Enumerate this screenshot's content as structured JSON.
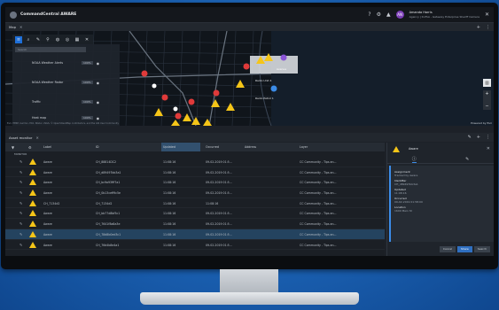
{
  "colors": {
    "background": "#1a5fb0",
    "accent": "#1e6fd9",
    "warning": "#f5c518",
    "selected_row": "#24435f"
  },
  "app": {
    "title": "CommandCentral AWARE",
    "header_icons": [
      "help-icon",
      "gear-icon",
      "bell-icon"
    ],
    "user": {
      "initials": "AN",
      "name": "Amanda Harris",
      "agency": "Agency | D-PSA - Gateway Enterprise Sheriff Camera"
    }
  },
  "map_panel": {
    "tab_label": "Map",
    "tools": [
      "layers-icon",
      "search-icon",
      "draw-icon",
      "pin-icon",
      "bulb-icon",
      "target-icon",
      "calendar-icon",
      "close-icon"
    ],
    "layer_search_placeholder": "Search",
    "layers": [
      {
        "name": "NOAA Weather Alerts",
        "pct": "100%"
      },
      {
        "name": "NOAA Weather Radar",
        "pct": "100%"
      },
      {
        "name": "Traffic",
        "pct": "100%"
      },
      {
        "name": "Heat map",
        "pct": "100%"
      }
    ],
    "labels": [
      {
        "text": "Avenue"
      },
      {
        "text": "Radio Patrol 1"
      },
      {
        "text": "Radio Unit 4"
      }
    ],
    "attribution": "Esri, HERE, Garmin, FAO, NOAA, USGS, © OpenStreetMap contributors, and the GIS User Community",
    "powered_by": "Powered by Esri"
  },
  "asset_monitor": {
    "title": "Asset monitor",
    "columns": [
      "Label",
      "ID",
      "Updated",
      "Occurred",
      "Address",
      "Layer"
    ],
    "group_label": "MONITOR",
    "rows": [
      {
        "label": "Aware",
        "id": "CH_88814DC2",
        "updated": "11:08:16",
        "occurred": "09-02-2019 01:5...",
        "address": "",
        "layer": "CC Community - Tips an..."
      },
      {
        "label": "Aware",
        "id": "CH_d89497bb3a1",
        "updated": "11:08:16",
        "occurred": "09-02-2019 01:5...",
        "address": "",
        "layer": "CC Community - Tips an..."
      },
      {
        "label": "Aware",
        "id": "CH_bc9a93fff7a1",
        "updated": "11:08:16",
        "occurred": "09-02-2019 01:5...",
        "address": "",
        "layer": "CC Community - Tips an..."
      },
      {
        "label": "Aware",
        "id": "CH_0b13ceff9c5e",
        "updated": "11:08:16",
        "occurred": "09-02-2019 01:5...",
        "address": "",
        "layer": "CC Community - Tips an..."
      },
      {
        "label": "CH_7134d2",
        "id": "CH_7134d2",
        "updated": "11:08:16",
        "occurred": "11:08:16",
        "address": "",
        "layer": "CC Community - Tips an..."
      },
      {
        "label": "Aware",
        "id": "CH_bb77d8bf5c1",
        "updated": "11:08:16",
        "occurred": "09-02-2019 01:5...",
        "address": "",
        "layer": "CC Community - Tips an..."
      },
      {
        "label": "Aware",
        "id": "CH_7641f8a8a3e",
        "updated": "11:08:16",
        "occurred": "09-02-2019 01:5...",
        "address": "",
        "layer": "CC Community - Tips an..."
      },
      {
        "label": "Aware",
        "id": "CH_78d8b0ed3c1",
        "updated": "11:08:16",
        "occurred": "09-02-2019 01:5...",
        "address": "",
        "layer": "CC Community - Tips an..."
      },
      {
        "label": "Aware",
        "id": "CH_76d4b8e4a1",
        "updated": "11:08:16",
        "occurred": "09-02-2019 01:5...",
        "address": "",
        "layer": "CC Community - Tips an..."
      }
    ],
    "selected_row_index": 7
  },
  "detail_panel": {
    "title": "Aware",
    "fields": [
      {
        "label": "Assignment",
        "value": "Tracked by Aware"
      },
      {
        "label": "Identifier",
        "value": "CH_d89497bb3a1"
      },
      {
        "label": "Updated",
        "value": "11:08:16"
      },
      {
        "label": "Occurred",
        "value": "09-02-2019 01:58:00"
      },
      {
        "label": "Location",
        "value": "1600 Main St"
      }
    ],
    "buttons": {
      "cancel": "Cancel",
      "share": "Share",
      "search": "Search"
    }
  }
}
